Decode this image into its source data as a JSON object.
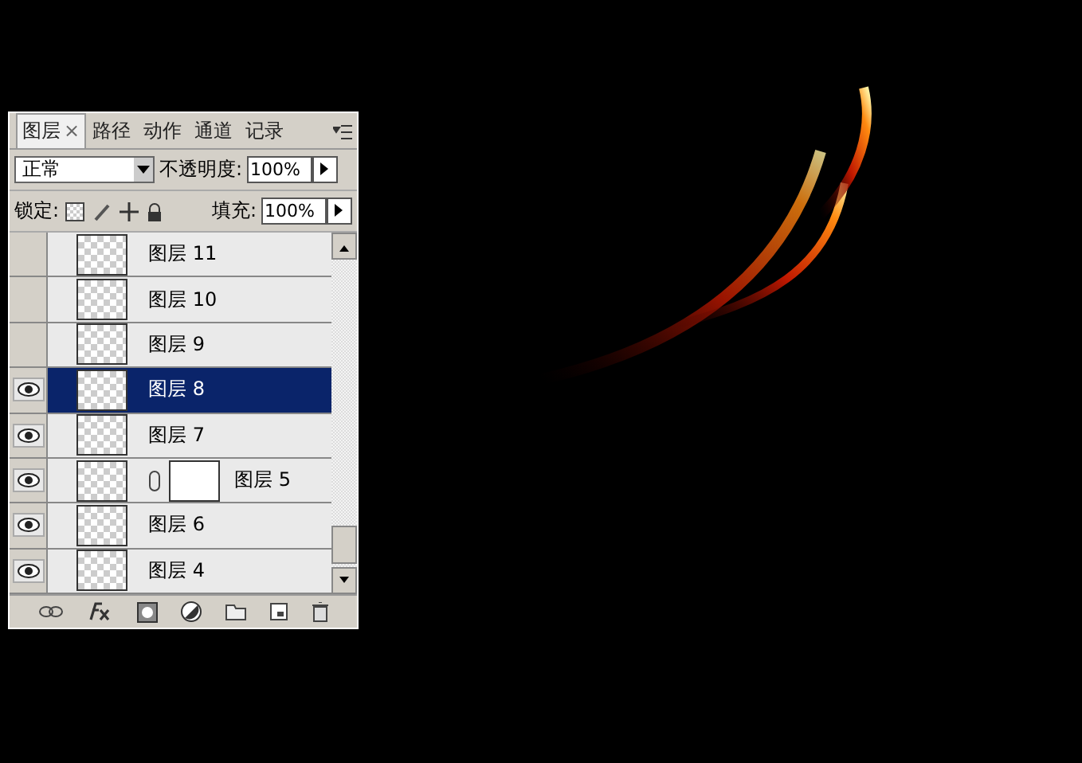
{
  "panel": {
    "tabs": [
      {
        "label": "图层",
        "selected": true,
        "close": "×"
      },
      {
        "label": "路径",
        "selected": false
      },
      {
        "label": "动作",
        "selected": false
      },
      {
        "label": "通道",
        "selected": false
      },
      {
        "label": "记录",
        "selected": false
      }
    ],
    "blend_mode": "正常",
    "opacity_label": "不透明度:",
    "opacity": "100%",
    "lock_label": "锁定:",
    "fill_label": "填充:",
    "fill": "100%",
    "layers": [
      {
        "name": "图层 11",
        "visible": false,
        "selected": false,
        "kind": "plain"
      },
      {
        "name": "图层 10",
        "visible": false,
        "selected": false,
        "kind": "plain"
      },
      {
        "name": "图层 9",
        "visible": false,
        "selected": false,
        "kind": "plain"
      },
      {
        "name": "图层 8",
        "visible": true,
        "selected": true,
        "kind": "plain"
      },
      {
        "name": "图层 7",
        "visible": true,
        "selected": false,
        "kind": "plain"
      },
      {
        "name": "图层 5",
        "visible": true,
        "selected": false,
        "kind": "masked"
      },
      {
        "name": "图层 6",
        "visible": true,
        "selected": false,
        "kind": "plain"
      },
      {
        "name": "图层 4",
        "visible": true,
        "selected": false,
        "kind": "plain"
      }
    ]
  }
}
